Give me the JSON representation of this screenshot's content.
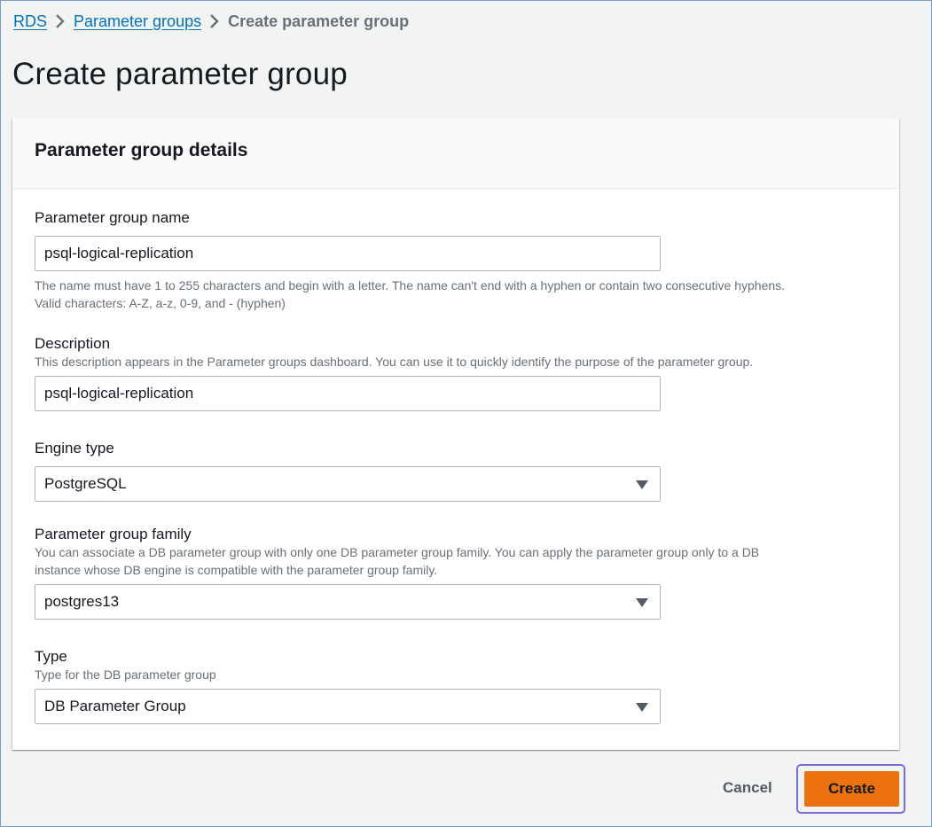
{
  "breadcrumb": {
    "items": [
      "RDS",
      "Parameter groups"
    ],
    "current": "Create parameter group"
  },
  "page": {
    "title": "Create parameter group"
  },
  "panel": {
    "title": "Parameter group details",
    "fields": {
      "name": {
        "label": "Parameter group name",
        "value": "psql-logical-replication",
        "constraint_line1": "The name must have 1 to 255 characters and begin with a letter. The name can't end with a hyphen or contain two consecutive hyphens.",
        "constraint_line2": "Valid characters: A-Z, a-z, 0-9, and - (hyphen)"
      },
      "description": {
        "label": "Description",
        "hint": "This description appears in the Parameter groups dashboard. You can use it to quickly identify the purpose of the parameter group.",
        "value": "psql-logical-replication"
      },
      "engine_type": {
        "label": "Engine type",
        "value": "PostgreSQL",
        "icon": "caret-down-icon"
      },
      "family": {
        "label": "Parameter group family",
        "hint_line1": "You can associate a DB parameter group with only one DB parameter group family. You can apply the parameter group only to a DB",
        "hint_line2": "instance whose DB engine is compatible with the parameter group family.",
        "value": "postgres13",
        "icon": "caret-down-icon"
      },
      "type": {
        "label": "Type",
        "hint": "Type for the DB parameter group",
        "value": "DB Parameter Group",
        "icon": "caret-down-icon"
      }
    }
  },
  "actions": {
    "cancel_label": "Cancel",
    "create_label": "Create"
  },
  "colors": {
    "link": "#0073bb",
    "primary_button": "#ec7211",
    "focus_ring": "#7e6bd9",
    "background": "#f2f3f3"
  }
}
